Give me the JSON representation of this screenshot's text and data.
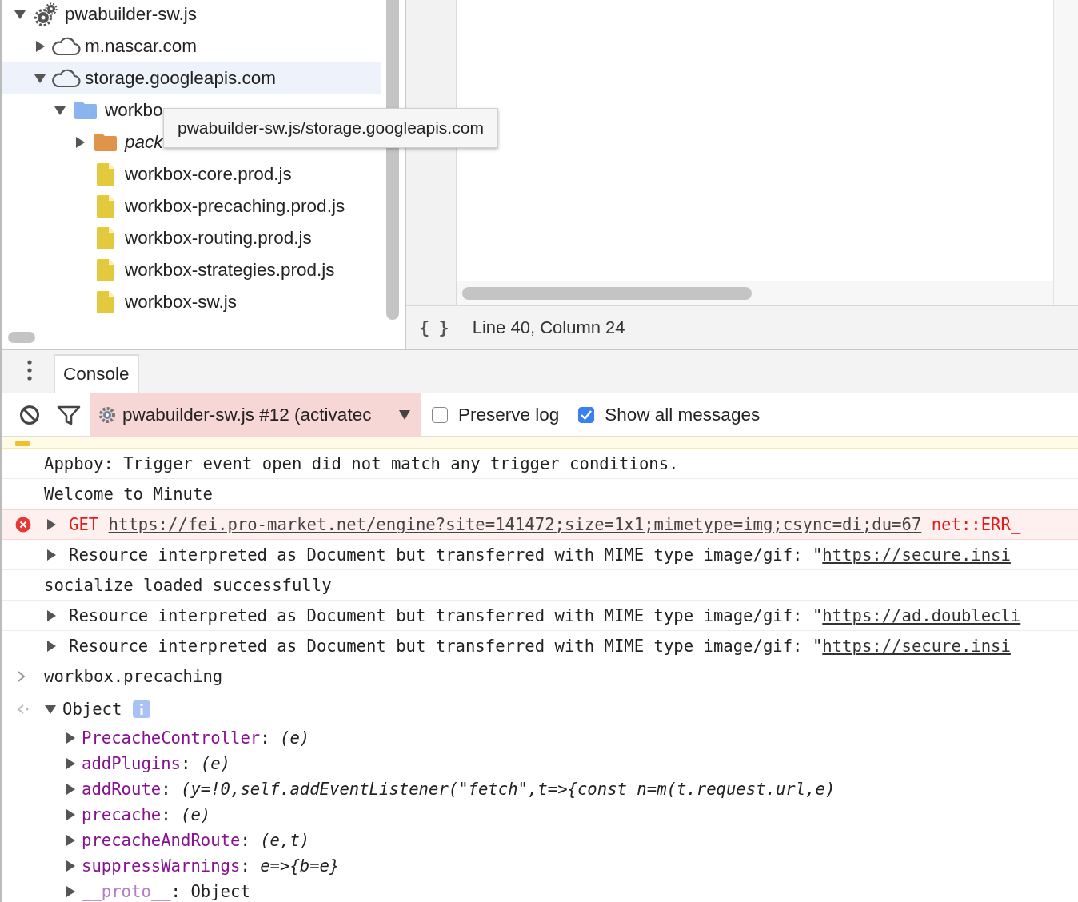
{
  "navigator": {
    "tree": [
      {
        "label": "pwabuilder-sw.js",
        "kind": "service-worker",
        "expanded": true,
        "selected": false,
        "children": [
          {
            "label": "m.nascar.com",
            "kind": "domain",
            "expanded": false,
            "selected": false
          },
          {
            "label": "storage.googleapis.com",
            "kind": "domain",
            "expanded": true,
            "selected": true,
            "children": [
              {
                "label": "workbo",
                "kind": "folder",
                "expanded": true,
                "selected": false,
                "children": [
                  {
                    "label": "pack",
                    "kind": "package-folder",
                    "expanded": false,
                    "selected": false
                  },
                  {
                    "label": "workbox-core.prod.js",
                    "kind": "file",
                    "selected": false
                  },
                  {
                    "label": "workbox-precaching.prod.js",
                    "kind": "file",
                    "selected": false
                  },
                  {
                    "label": "workbox-routing.prod.js",
                    "kind": "file",
                    "selected": false
                  },
                  {
                    "label": "workbox-strategies.prod.js",
                    "kind": "file",
                    "selected": false
                  },
                  {
                    "label": "workbox-sw.js",
                    "kind": "file",
                    "selected": false
                  }
                ]
              }
            ]
          }
        ]
      }
    ],
    "tooltip": "pwabuilder-sw.js/storage.googleapis.com"
  },
  "editor": {
    "format_button": "{ }",
    "cursor_position": "Line 40, Column 24"
  },
  "drawer": {
    "tabs": [
      {
        "label": "Console",
        "selected": true
      }
    ]
  },
  "console_toolbar": {
    "context": "pwabuilder-sw.js #12 (activatec",
    "checkboxes": [
      {
        "label": "Preserve log",
        "checked": false
      },
      {
        "label": "Show all messages",
        "checked": true
      }
    ]
  },
  "messages": [
    {
      "kind": "warning"
    },
    {
      "kind": "log",
      "expandable": false,
      "text": "Appboy: Trigger event open did not match any trigger conditions."
    },
    {
      "kind": "log",
      "expandable": false,
      "text": "Welcome to Minute"
    },
    {
      "kind": "error",
      "expandable": true,
      "text": "GET ",
      "link": "https://fei.pro-market.net/engine?site=141472;size=1x1;mimetype=img;csync=di;du=67",
      "after": " net::ERR_"
    },
    {
      "kind": "log",
      "expandable": true,
      "text": "Resource interpreted as Document but transferred with MIME type image/gif: \"",
      "link": "https://secure.insi"
    },
    {
      "kind": "log",
      "expandable": false,
      "text": "socialize loaded successfully"
    },
    {
      "kind": "log",
      "expandable": true,
      "text": "Resource interpreted as Document but transferred with MIME type image/gif: \"",
      "link": "https://ad.doublecli"
    },
    {
      "kind": "log",
      "expandable": true,
      "text": "Resource interpreted as Document but transferred with MIME type image/gif: \"",
      "link": "https://secure.insi"
    }
  ],
  "command": "workbox.precaching",
  "result": {
    "label": "Object",
    "expanded": true,
    "properties": [
      {
        "name": "PrecacheController",
        "separator": ":",
        "value": "(e)",
        "kind": "function"
      },
      {
        "name": "addPlugins",
        "separator": ":",
        "value": "(e)",
        "kind": "function"
      },
      {
        "name": "addRoute",
        "separator": ":",
        "value": "(y=!0,self.addEventListener(\"fetch\",t=>{const n=m(t.request.url,e)",
        "kind": "function"
      },
      {
        "name": "precache",
        "separator": ":",
        "value": "(e)",
        "kind": "function"
      },
      {
        "name": "precacheAndRoute",
        "separator": ":",
        "value": "(e,t)",
        "kind": "function"
      },
      {
        "name": "suppressWarnings",
        "separator": ":",
        "value": "e=>{b=e}",
        "kind": "function"
      },
      {
        "name": "__proto__",
        "separator": ":",
        "value": "Object",
        "kind": "prototype"
      }
    ]
  }
}
